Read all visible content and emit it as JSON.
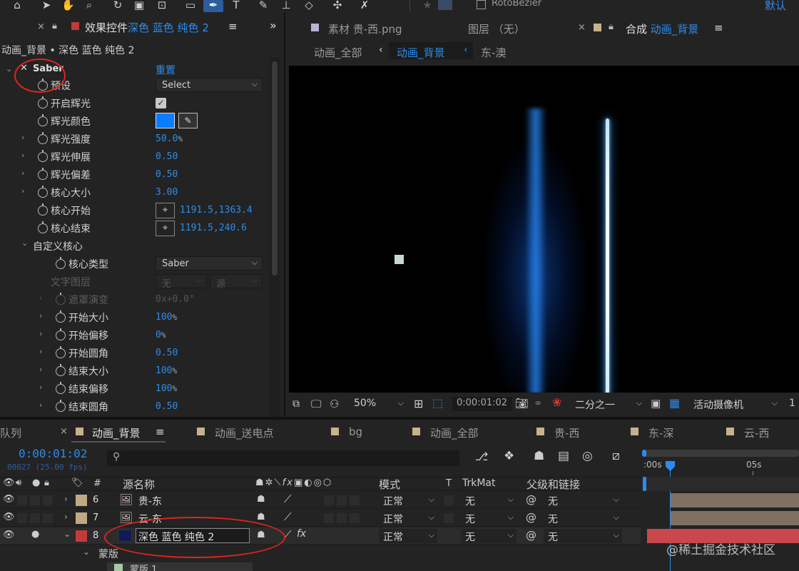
{
  "toolbar": {
    "rotobezier_label": "RotoBezier",
    "workspace_label": "默认"
  },
  "effect_panel": {
    "tab_title_prefix": "效果控件",
    "tab_title_layer": "深色 蓝色 纯色 2",
    "breadcrumb": "动画_背景 • 深色 蓝色 纯色 2",
    "effect_name": "Saber",
    "reset_label": "重置",
    "rows": {
      "preset": {
        "label": "预设",
        "value": "Select"
      },
      "enable_glow": {
        "label": "开启辉光",
        "checked": true
      },
      "glow_color": {
        "label": "辉光颜色",
        "color": "#0a7cff"
      },
      "glow_intensity": {
        "label": "辉光强度",
        "value": "50.0",
        "unit": "%"
      },
      "glow_spread": {
        "label": "辉光伸展",
        "value": "0.50"
      },
      "glow_bias": {
        "label": "辉光偏差",
        "value": "0.50"
      },
      "core_size": {
        "label": "核心大小",
        "value": "3.00"
      },
      "core_start": {
        "label": "核心开始",
        "value": "1191.5,1363.4"
      },
      "core_end": {
        "label": "核心结束",
        "value": "1191.5,240.6"
      },
      "custom_core": {
        "label": "自定义核心"
      },
      "core_type": {
        "label": "核心类型",
        "value": "Saber"
      },
      "text_layer": {
        "label": "文字图层",
        "value": "无",
        "source": "源"
      },
      "mask_evolution": {
        "label": "遮罩演变",
        "value": "0x+0.0°"
      },
      "start_size": {
        "label": "开始大小",
        "value": "100",
        "unit": "%"
      },
      "start_offset": {
        "label": "开始偏移",
        "value": "0",
        "unit": "%"
      },
      "start_roundness": {
        "label": "开始圆角",
        "value": "0.50"
      },
      "end_size": {
        "label": "结束大小",
        "value": "100",
        "unit": "%"
      },
      "end_offset": {
        "label": "结束偏移",
        "value": "100",
        "unit": "%"
      },
      "end_roundness": {
        "label": "结束圆角",
        "value": "0.50"
      }
    }
  },
  "viewer": {
    "tab_footage": "素材 贵-西.png",
    "tab_layer": "图层 （无）",
    "tab_comp_prefix": "合成",
    "tab_comp_name": "动画_背景",
    "nav_left": "动画_全部",
    "nav_current": "动画_背景",
    "nav_right": "东-澳",
    "zoom": "50%",
    "timecode": "0:00:01:02",
    "resolution": "二分之一",
    "camera": "活动摄像机",
    "views": "1"
  },
  "timeline": {
    "tabs": [
      "队列",
      "动画_背景",
      "动画_送电点",
      "bg",
      "动画_全部",
      "贵-西",
      "东-深",
      "云-西"
    ],
    "tab_colors": [
      "",
      "#c7b28c",
      "#c7b28c",
      "#c7b28c",
      "#c7b28c",
      "#c7b28c",
      "#c7b28c",
      "#c7b28c"
    ],
    "timecode": "0:00:01:02",
    "frame_info": "00027 (25.00 fps)",
    "search_placeholder": "",
    "headers": {
      "num": "#",
      "source_name": "源名称",
      "mode": "模式",
      "t": "T",
      "trkmat": "TrkMat",
      "parent": "父级和链接"
    },
    "ruler": {
      "start": ":00s",
      "mark": "05s"
    },
    "layers": [
      {
        "num": "6",
        "name": "贵-东",
        "mode": "正常",
        "trkmat": "无",
        "parent": "无",
        "color": "#bfaa85"
      },
      {
        "num": "7",
        "name": "云-东",
        "mode": "正常",
        "trkmat": "无",
        "parent": "无",
        "color": "#bfaa85"
      },
      {
        "num": "8",
        "name": "深色 蓝色 纯色 2",
        "mode": "正常",
        "trkmat": "无",
        "parent": "无",
        "color": "#c23a3a"
      }
    ],
    "mask_group": "蒙版",
    "mask_item": "蒙版 1"
  },
  "watermark": "@稀土掘金技术社区"
}
